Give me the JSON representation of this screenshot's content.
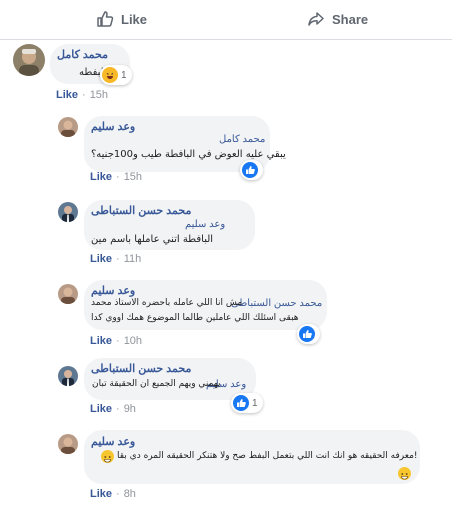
{
  "colors": {
    "link_blue": "#385898",
    "bubble_bg": "#f2f3f5",
    "meta_gray": "#90949c",
    "like_blue": "#1877f2",
    "haha_yellow": "#f7b928"
  },
  "actions": {
    "like_label": "Like",
    "like_icon": "thumbs-up-outline-icon",
    "share_label": "Share",
    "share_icon": "share-arrow-icon"
  },
  "comments": [
    {
      "author": "محمد كامل",
      "text": "من البفطه",
      "reaction": {
        "type": "haha",
        "count": "1"
      },
      "like": "Like",
      "time": "15h"
    }
  ],
  "replies": [
    {
      "author": "وعد سليم",
      "mention": "محمد كامل",
      "text": "يبقي عليه العوض في البافطة طيب و100جنيه؟",
      "reaction": {
        "type": "like",
        "count": ""
      },
      "like": "Like",
      "time": "15h"
    },
    {
      "author": "محمد حسن الستباطى",
      "mention": "وعد سليم",
      "text": "البافطة اتني عاملها باسم مين",
      "reaction": null,
      "like": "Like",
      "time": "11h"
    },
    {
      "author": "وعد سليم",
      "mention": "محمد حسن الستباطى",
      "text_line1": "مش انا اللي عامله باحضره الاستاذ محمد",
      "text_line2": "هبقى اسئلك اللي عاملين طالما الموضوع همك اووي كدا",
      "reaction": {
        "type": "like",
        "count": ""
      },
      "like": "Like",
      "time": "10h"
    },
    {
      "author": "محمد حسن الستباطى",
      "mention": "وعد سليم",
      "text": "يهمني ويهم الجميع ان الحقيقة تبان",
      "reaction": {
        "type": "like",
        "count": "1"
      },
      "like": "Like",
      "time": "9h"
    },
    {
      "author": "وعد سليم",
      "text_line1": "معرفه الحقيقه هو انك انت اللي بتعمل البفط صح ولا هتنكر الحقيقه المره دي بقا!",
      "reaction": null,
      "like": "Like",
      "time": "8h"
    }
  ]
}
